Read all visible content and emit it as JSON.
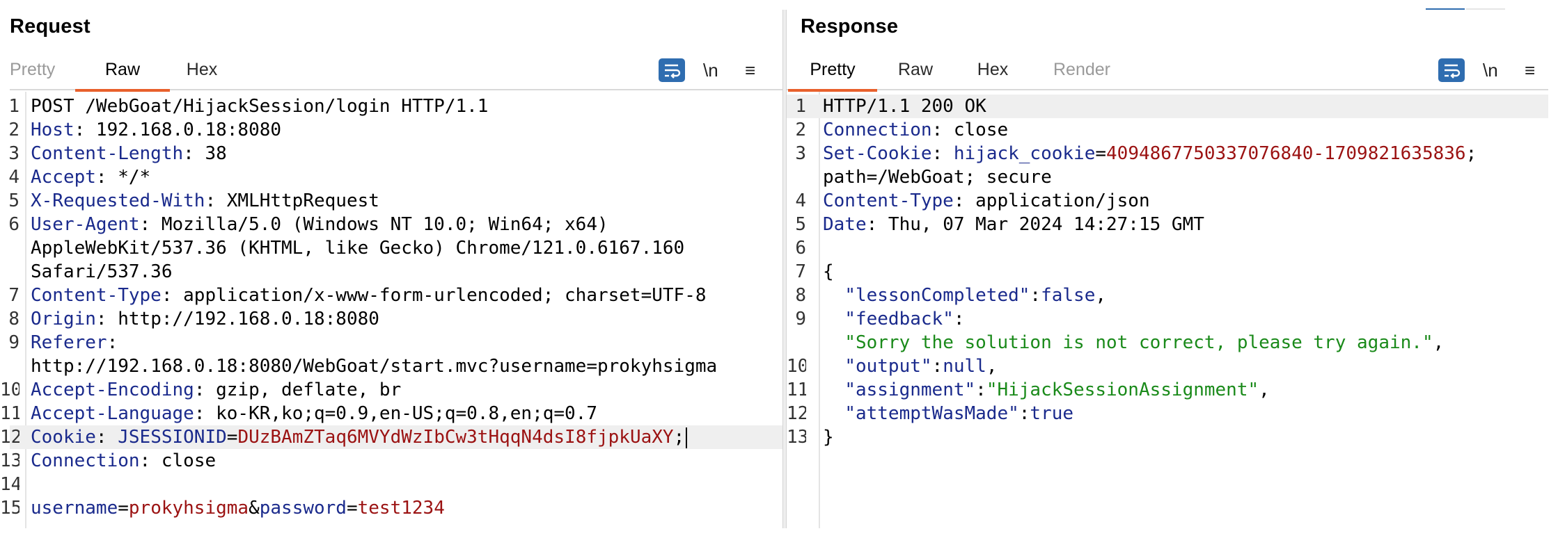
{
  "request": {
    "title": "Request",
    "tabs": [
      "Pretty",
      "Raw",
      "Hex"
    ],
    "active_tab": "Raw",
    "tools": {
      "newline_label": "\\n",
      "menu_glyph": "≡"
    },
    "lines": [
      {
        "num": "1",
        "parts": [
          {
            "t": "POST /WebGoat/HijackSession/login HTTP/1.1",
            "c": "v"
          }
        ]
      },
      {
        "num": "2",
        "parts": [
          {
            "t": "Host",
            "c": "k"
          },
          {
            "t": ": 192.168.0.18:8080",
            "c": "v"
          }
        ]
      },
      {
        "num": "3",
        "parts": [
          {
            "t": "Content-Length",
            "c": "k"
          },
          {
            "t": ": 38",
            "c": "v"
          }
        ]
      },
      {
        "num": "4",
        "parts": [
          {
            "t": "Accept",
            "c": "k"
          },
          {
            "t": ": */*",
            "c": "v"
          }
        ]
      },
      {
        "num": "5",
        "parts": [
          {
            "t": "X-Requested-With",
            "c": "k"
          },
          {
            "t": ": XMLHttpRequest",
            "c": "v"
          }
        ]
      },
      {
        "num": "6",
        "parts": [
          {
            "t": "User-Agent",
            "c": "k"
          },
          {
            "t": ": Mozilla/5.0 (Windows NT 10.0; Win64; x64)",
            "c": "v"
          }
        ]
      },
      {
        "num": "",
        "parts": [
          {
            "t": "AppleWebKit/537.36 (KHTML, like Gecko) Chrome/121.0.6167.160",
            "c": "v"
          }
        ]
      },
      {
        "num": "",
        "parts": [
          {
            "t": "Safari/537.36",
            "c": "v"
          }
        ]
      },
      {
        "num": "7",
        "parts": [
          {
            "t": "Content-Type",
            "c": "k"
          },
          {
            "t": ": application/x-www-form-urlencoded; charset=UTF-8",
            "c": "v"
          }
        ]
      },
      {
        "num": "8",
        "parts": [
          {
            "t": "Origin",
            "c": "k"
          },
          {
            "t": ": http://192.168.0.18:8080",
            "c": "v"
          }
        ]
      },
      {
        "num": "9",
        "parts": [
          {
            "t": "Referer",
            "c": "k"
          },
          {
            "t": ":",
            "c": "v"
          }
        ]
      },
      {
        "num": "",
        "parts": [
          {
            "t": "http://192.168.0.18:8080/WebGoat/start.mvc?username=prokyhsigma",
            "c": "v"
          }
        ]
      },
      {
        "num": "10",
        "parts": [
          {
            "t": "Accept-Encoding",
            "c": "k"
          },
          {
            "t": ": gzip, deflate, br",
            "c": "v"
          }
        ]
      },
      {
        "num": "11",
        "parts": [
          {
            "t": "Accept-Language",
            "c": "k"
          },
          {
            "t": ": ko-KR,ko;q=0.9,en-US;q=0.8,en;q=0.7",
            "c": "v"
          }
        ]
      },
      {
        "num": "12",
        "hl": true,
        "caret": true,
        "parts": [
          {
            "t": "Cookie",
            "c": "k"
          },
          {
            "t": ": ",
            "c": "v"
          },
          {
            "t": "JSESSIONID",
            "c": "k"
          },
          {
            "t": "=",
            "c": "v"
          },
          {
            "t": "DUzBAmZTaq6MVYdWzIbCw3tHqqN4dsI8fjpkUaXY",
            "c": "c"
          },
          {
            "t": ";",
            "c": "v"
          }
        ]
      },
      {
        "num": "13",
        "parts": [
          {
            "t": "Connection",
            "c": "k"
          },
          {
            "t": ": close",
            "c": "v"
          }
        ]
      },
      {
        "num": "14",
        "parts": []
      },
      {
        "num": "15",
        "parts": [
          {
            "t": "username",
            "c": "k"
          },
          {
            "t": "=",
            "c": "v"
          },
          {
            "t": "prokyhsigma",
            "c": "c"
          },
          {
            "t": "&",
            "c": "v"
          },
          {
            "t": "password",
            "c": "k"
          },
          {
            "t": "=",
            "c": "v"
          },
          {
            "t": "test1234",
            "c": "c"
          }
        ]
      }
    ]
  },
  "response": {
    "title": "Response",
    "tabs": [
      "Pretty",
      "Raw",
      "Hex",
      "Render"
    ],
    "active_tab": "Pretty",
    "tools": {
      "newline_label": "\\n",
      "menu_glyph": "≡"
    },
    "lines": [
      {
        "num": "1",
        "hl": true,
        "parts": [
          {
            "t": "HTTP/1.1 200 OK",
            "c": "v"
          }
        ]
      },
      {
        "num": "2",
        "parts": [
          {
            "t": "Connection",
            "c": "k"
          },
          {
            "t": ": close",
            "c": "v"
          }
        ]
      },
      {
        "num": "3",
        "parts": [
          {
            "t": "Set-Cookie",
            "c": "k"
          },
          {
            "t": ": ",
            "c": "v"
          },
          {
            "t": "hijack_cookie",
            "c": "k"
          },
          {
            "t": "=",
            "c": "v"
          },
          {
            "t": "4094867750337076840-1709821635836",
            "c": "c"
          },
          {
            "t": ";",
            "c": "v"
          }
        ]
      },
      {
        "num": "",
        "parts": [
          {
            "t": "path=/WebGoat; secure",
            "c": "v"
          }
        ]
      },
      {
        "num": "4",
        "parts": [
          {
            "t": "Content-Type",
            "c": "k"
          },
          {
            "t": ": application/json",
            "c": "v"
          }
        ]
      },
      {
        "num": "5",
        "parts": [
          {
            "t": "Date",
            "c": "k"
          },
          {
            "t": ": Thu, 07 Mar 2024 14:27:15 GMT",
            "c": "v"
          }
        ]
      },
      {
        "num": "6",
        "parts": []
      },
      {
        "num": "7",
        "parts": [
          {
            "t": "{",
            "c": "v"
          }
        ]
      },
      {
        "num": "8",
        "parts": [
          {
            "t": "  ",
            "c": "v"
          },
          {
            "t": "\"lessonCompleted\"",
            "c": "k"
          },
          {
            "t": ":",
            "c": "v"
          },
          {
            "t": "false",
            "c": "k"
          },
          {
            "t": ",",
            "c": "v"
          }
        ]
      },
      {
        "num": "9",
        "parts": [
          {
            "t": "  ",
            "c": "v"
          },
          {
            "t": "\"feedback\"",
            "c": "k"
          },
          {
            "t": ":",
            "c": "v"
          }
        ]
      },
      {
        "num": "",
        "parts": [
          {
            "t": "  ",
            "c": "v"
          },
          {
            "t": "\"Sorry the solution is not correct, please try again.\"",
            "c": "s"
          },
          {
            "t": ",",
            "c": "v"
          }
        ]
      },
      {
        "num": "10",
        "parts": [
          {
            "t": "  ",
            "c": "v"
          },
          {
            "t": "\"output\"",
            "c": "k"
          },
          {
            "t": ":",
            "c": "v"
          },
          {
            "t": "null",
            "c": "k"
          },
          {
            "t": ",",
            "c": "v"
          }
        ]
      },
      {
        "num": "11",
        "parts": [
          {
            "t": "  ",
            "c": "v"
          },
          {
            "t": "\"assignment\"",
            "c": "k"
          },
          {
            "t": ":",
            "c": "v"
          },
          {
            "t": "\"HijackSessionAssignment\"",
            "c": "s"
          },
          {
            "t": ",",
            "c": "v"
          }
        ]
      },
      {
        "num": "12",
        "parts": [
          {
            "t": "  ",
            "c": "v"
          },
          {
            "t": "\"attemptWasMade\"",
            "c": "k"
          },
          {
            "t": ":",
            "c": "v"
          },
          {
            "t": "true",
            "c": "k"
          }
        ]
      },
      {
        "num": "13",
        "parts": [
          {
            "t": "}",
            "c": "v"
          }
        ]
      }
    ]
  },
  "icons": {
    "wrap": "wrap-lines-icon",
    "menu": "menu-icon"
  },
  "colors": {
    "accent_tab": "#e8602c",
    "wrap_button": "#2f6db0",
    "key": "#1a2a8c",
    "cookie_value": "#9b1212",
    "json_string": "#1a8a1a"
  }
}
